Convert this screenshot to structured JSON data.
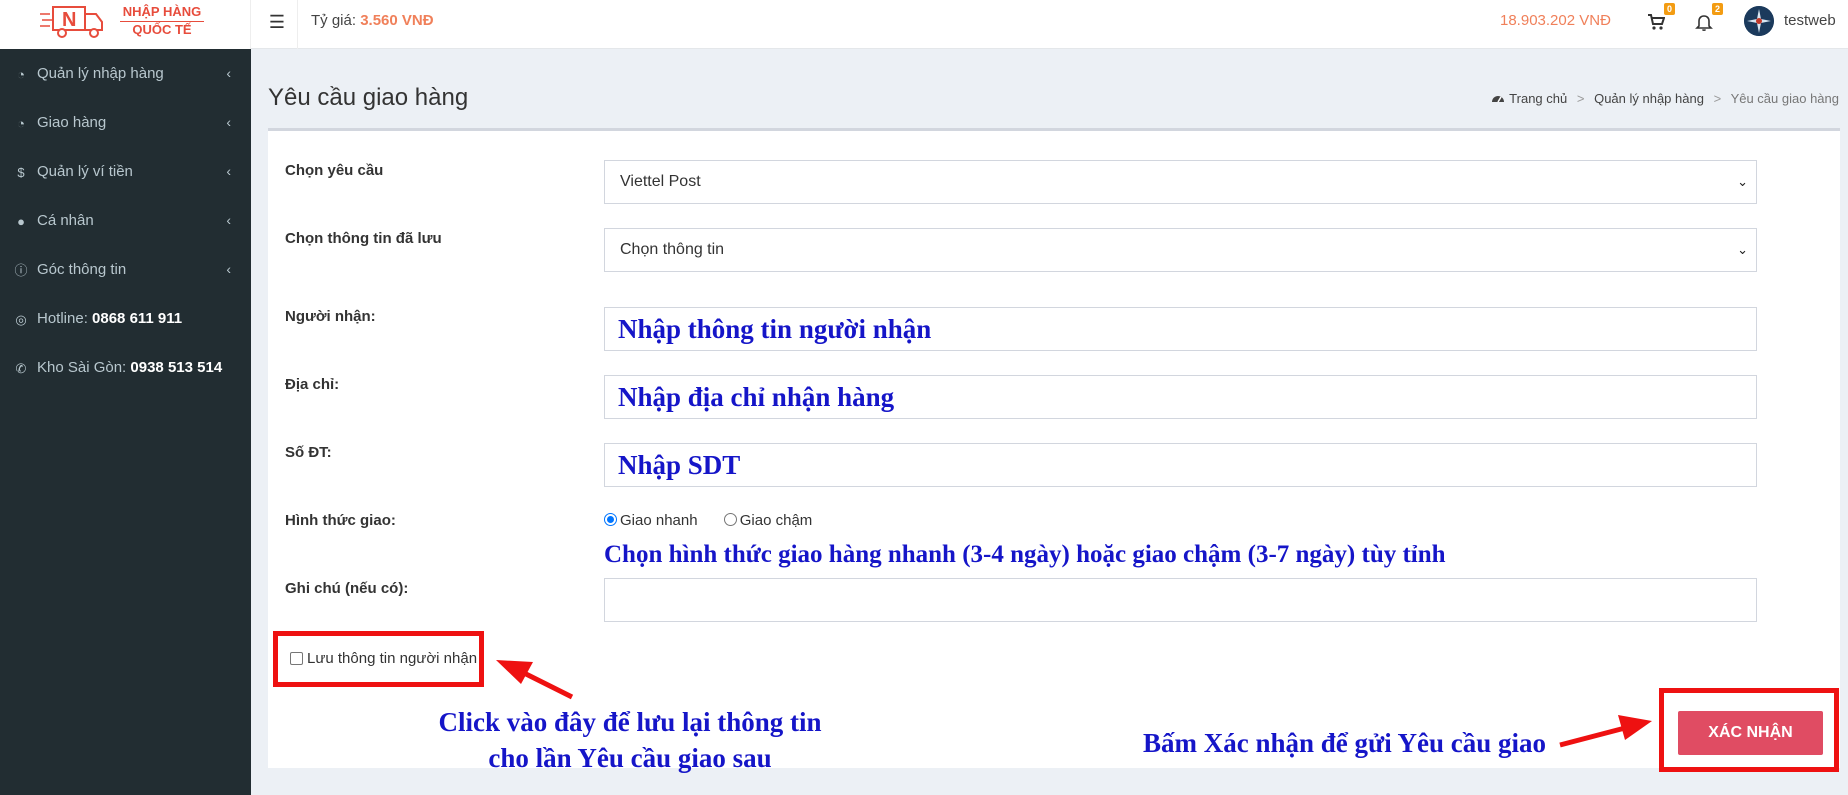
{
  "brand": {
    "line1": "NHẬP HÀNG",
    "line2": "QUỐC TẾ",
    "color": "#e74c3c"
  },
  "header": {
    "menu_icon": "hamburger-icon",
    "rate_label": "Tỷ giá:",
    "rate_value": "3.560 VNĐ",
    "balance": "18.903.202 VNĐ",
    "cart_count": "0",
    "notification_count": "2",
    "username": "testweb"
  },
  "sidebar": {
    "items": [
      {
        "icon": "pie-chart-icon",
        "label": "Quản lý nhập hàng"
      },
      {
        "icon": "pie-chart-icon",
        "label": "Giao hàng"
      },
      {
        "icon": "dollar-icon",
        "label": "Quản lý ví tiền"
      },
      {
        "icon": "user-icon",
        "label": "Cá nhân"
      },
      {
        "icon": "info-icon",
        "label": "Góc thông tin"
      }
    ],
    "hotline_label": "Hotline:",
    "hotline_number": "0868 611 911",
    "warehouse_label": "Kho Sài Gòn:",
    "warehouse_number": "0938 513 514"
  },
  "page": {
    "title": "Yêu cầu giao hàng",
    "breadcrumb": [
      "Trang chủ",
      "Quản lý nhập hàng",
      "Yêu cầu giao hàng"
    ]
  },
  "form": {
    "request_label": "Chọn yêu cầu",
    "request_value": "Viettel Post",
    "saved_label": "Chọn thông tin đã lưu",
    "saved_value": "Chọn thông tin",
    "receiver_label": "Người nhận:",
    "receiver_hint": "Nhập thông tin người nhận",
    "address_label": "Địa chỉ:",
    "address_hint": "Nhập địa chỉ nhận hàng",
    "phone_label": "Số ĐT:",
    "phone_hint": "Nhập SDT",
    "shipping_label": "Hình thức giao:",
    "shipping_options": [
      "Giao nhanh",
      "Giao chậm"
    ],
    "shipping_selected": "Giao nhanh",
    "shipping_note": "Chọn hình thức giao hàng nhanh (3-4 ngày) hoặc giao chậm (3-7 ngày) tùy tỉnh",
    "note_label": "Ghi chú (nếu có):",
    "note_value": "",
    "save_info_label": "Lưu thông tin người nhận",
    "confirm_label": "XÁC NHẬN"
  },
  "annotations": {
    "save_note_line1": "Click vào đây để lưu lại thông tin",
    "save_note_line2": "cho lần Yêu cầu giao sau",
    "confirm_note": "Bấm Xác nhận để gửi Yêu cầu giao",
    "highlight_color": "#ee1111",
    "text_color": "#1515c8"
  },
  "colors": {
    "accent": "#f0805a",
    "sidebar_bg": "#222d32",
    "button": "#e04c63"
  }
}
